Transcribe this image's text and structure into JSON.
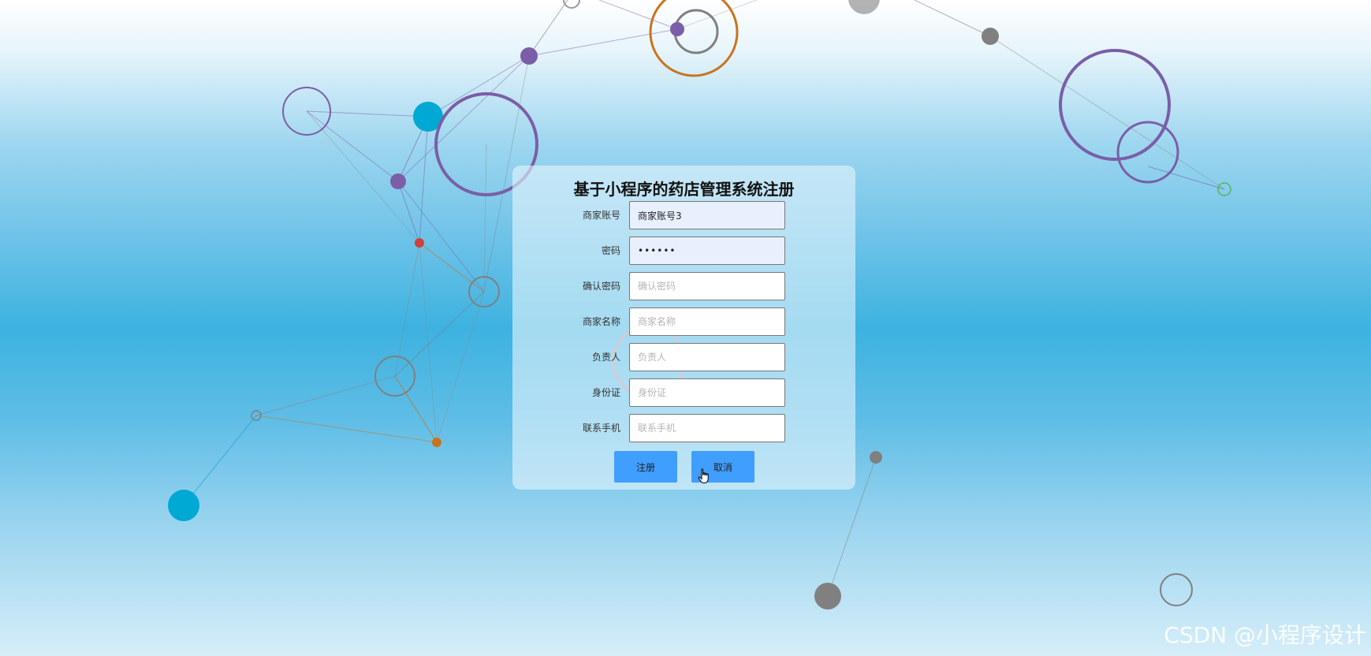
{
  "form": {
    "title": "基于小程序的药店管理系统注册",
    "fields": [
      {
        "label": "商家账号",
        "value": "商家账号3",
        "placeholder": "商家账号",
        "type": "text"
      },
      {
        "label": "密码",
        "value": "••••••",
        "placeholder": "密码",
        "type": "password"
      },
      {
        "label": "确认密码",
        "value": "",
        "placeholder": "确认密码",
        "type": "password"
      },
      {
        "label": "商家名称",
        "value": "",
        "placeholder": "商家名称",
        "type": "text"
      },
      {
        "label": "负责人",
        "value": "",
        "placeholder": "负责人",
        "type": "text"
      },
      {
        "label": "身份证",
        "value": "",
        "placeholder": "身份证",
        "type": "text"
      },
      {
        "label": "联系手机",
        "value": "",
        "placeholder": "联系手机",
        "type": "text"
      }
    ],
    "register_label": "注册",
    "cancel_label": "取消"
  },
  "watermark": "CSDN @小程序设计",
  "colors": {
    "button": "#409eff",
    "filled_input": "#e8f0fe",
    "purple": "#7b5ea7",
    "cyan": "#00a8d4",
    "orange": "#c8741c",
    "gray": "#808080",
    "red": "#d0403a"
  }
}
